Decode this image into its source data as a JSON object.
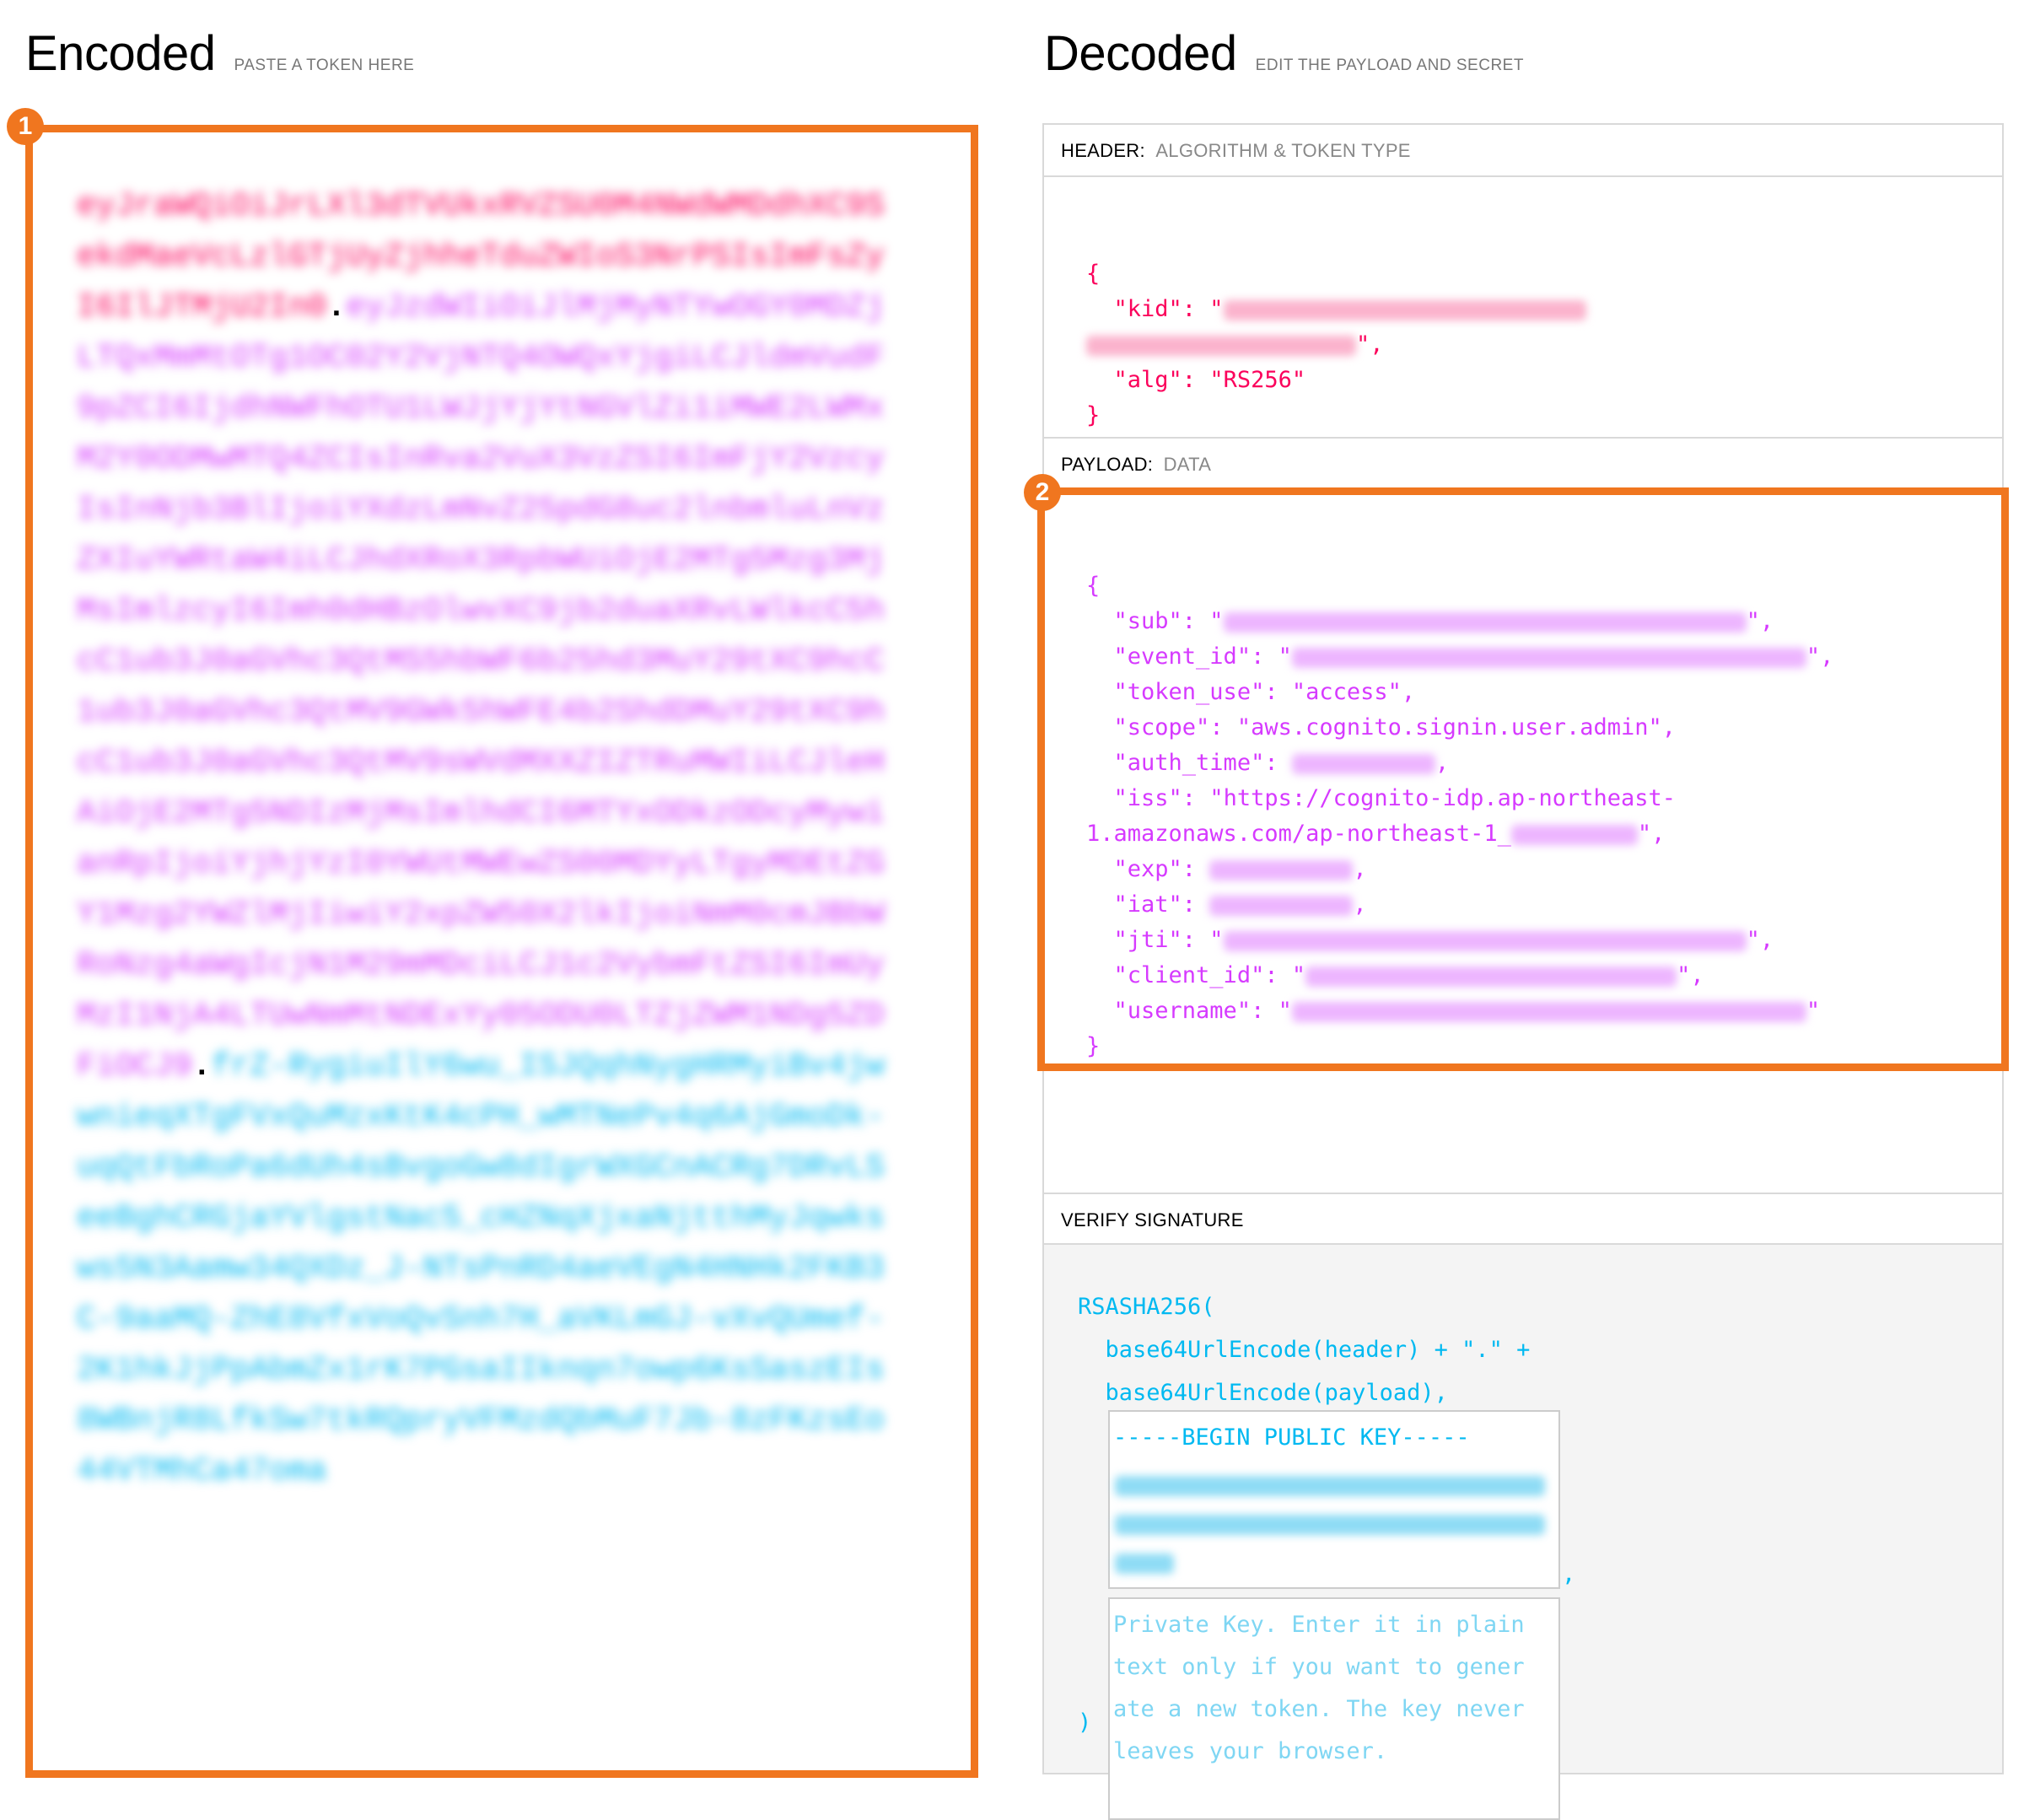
{
  "encoded": {
    "title": "Encoded",
    "subtitle": "PASTE A TOKEN HERE",
    "marker": "1",
    "token_header": "eyJraWQiOiJrLXl3dTVUkxRVZSU0M4NWdWMDdhXC9SekdMaeVcLzlGTjUyZjhheTduZWIoS3NrPSIsImFsZyI6IlJTMjU2In0",
    "token_payload": "eyJzdWIiOiJlMjMyNTYwOGY0MDZjLTQxMmMtOTg1OC02Y2VjNTQ4OWQxYjgiLCJldmVudF9pZCI6IjdhNWFhOTU1LWJjYjYtNGVlZi1iMWE2LWMxM2Y0ODMwMTQ4ZCIsInRva2VuX3VzZSI6ImFjY2VzcyIsInNjb3BlIjoiYXdzLmNvZ25pdG8uc2lnbmluLnVzZXIuYWRtaW4iLCJhdXRoX3RpbWUiOjE2MTg5Mzg3MjMsImlzcyI6Imh0dHBzOlwvXC9jb2duaXRvLWlkcC5hcC1ub3J0aGVhc3QtMS5hbWF6b25hd3MuY29tXC9hcC1ub3J0aGVhc3QtMV9GWk5hWFE4b2ShdDMuY29tXC9hcC1ub3J0aGVhc3QtMV9sWVdMXXZIZTRuMWIiLCJleHAiOjE2MTg5NDIzMjMsImlhdCI6MTYxODkzODcyMywianRpIjoiYjhjYzI0YWUtMWEwZS00MDYyLTgyMDEtZGY1Mzg2YWZlMjIiwiY2xpZW50X2lkIjoiNmM0cmJBbWRoNzg4aWgIcjN1M29mMDciLCJ1c2VybmFtZSI6ImUyMzI1NjA4LTUwNmMtNDExYy05ODU0LTZjZWM1NDg5ZDFiOCJ9",
    "token_signature": "frZ-RygiuIlY6wu_ISJQqhNygHRMyiBv4jwwnieqXTgFVxQuMzxKtK4cPH_wMTNePv4q6AjGmoDk-uqQtFbRoPa6dUh4sBvgoGw8dIgrWXGCnACRg7DRvLSeeBghCRGjaYVlgstNac5_cHZNqXjxaNjtthMyJqwksws5N3Aamw34QXDz_J-NTsPnRD4aeVEgN4HNHk2FKB3C-9aaMQ-ZhE8VfxVoQvSnh7H_aVKLmGJ-vXvQUmef-2K1hkJjPpAbmZx1rK7PGsaIIknqn7owp6KsSaszEIs8WBnjR8LfkSw7tkRQpryVFMzdQbMuF7Jb-8zFKzsEo44VTMhCa47oma"
  },
  "decoded": {
    "title": "Decoded",
    "subtitle": "EDIT THE PAYLOAD AND SECRET",
    "marker": "2",
    "header_section": {
      "label": "HEADER:",
      "sub": "ALGORITHM & TOKEN TYPE"
    },
    "header_json": {
      "kid_key": "\"kid\"",
      "alg_key": "\"alg\"",
      "alg_value": "\"RS256\""
    },
    "payload_section": {
      "label": "PAYLOAD:",
      "sub": "DATA"
    },
    "payload_json": {
      "sub_key": "\"sub\"",
      "event_id_key": "\"event_id\"",
      "token_use_key": "\"token_use\"",
      "token_use_value": "\"access\"",
      "scope_key": "\"scope\"",
      "scope_value": "\"aws.cognito.signin.user.admin\"",
      "auth_time_key": "\"auth_time\"",
      "iss_key": "\"iss\"",
      "iss_value_line1": "\"https://cognito-idp.ap-northeast-",
      "iss_value_line2": "1.amazonaws.com/ap-northeast-1_",
      "exp_key": "\"exp\"",
      "iat_key": "\"iat\"",
      "jti_key": "\"jti\"",
      "client_id_key": "\"client_id\"",
      "username_key": "\"username\""
    },
    "signature_section": {
      "label": "VERIFY SIGNATURE"
    },
    "signature": {
      "fn_open": "RSASHA256(",
      "line_header": "base64UrlEncode(header) + \".\" +",
      "line_payload": "base64UrlEncode(payload),",
      "public_key_begin": "-----BEGIN PUBLIC KEY-----",
      "comma": ",",
      "private_key_placeholder_lines": [
        "Private Key. Enter it in plain",
        "text only if you want to gener",
        "ate a new token. The key never",
        "leaves your browser."
      ],
      "fn_close": ")"
    }
  },
  "colors": {
    "accent_marker": "#f0761f",
    "token_header": "#fb015b",
    "token_payload": "#d63aff",
    "token_signature": "#00b9f1"
  }
}
